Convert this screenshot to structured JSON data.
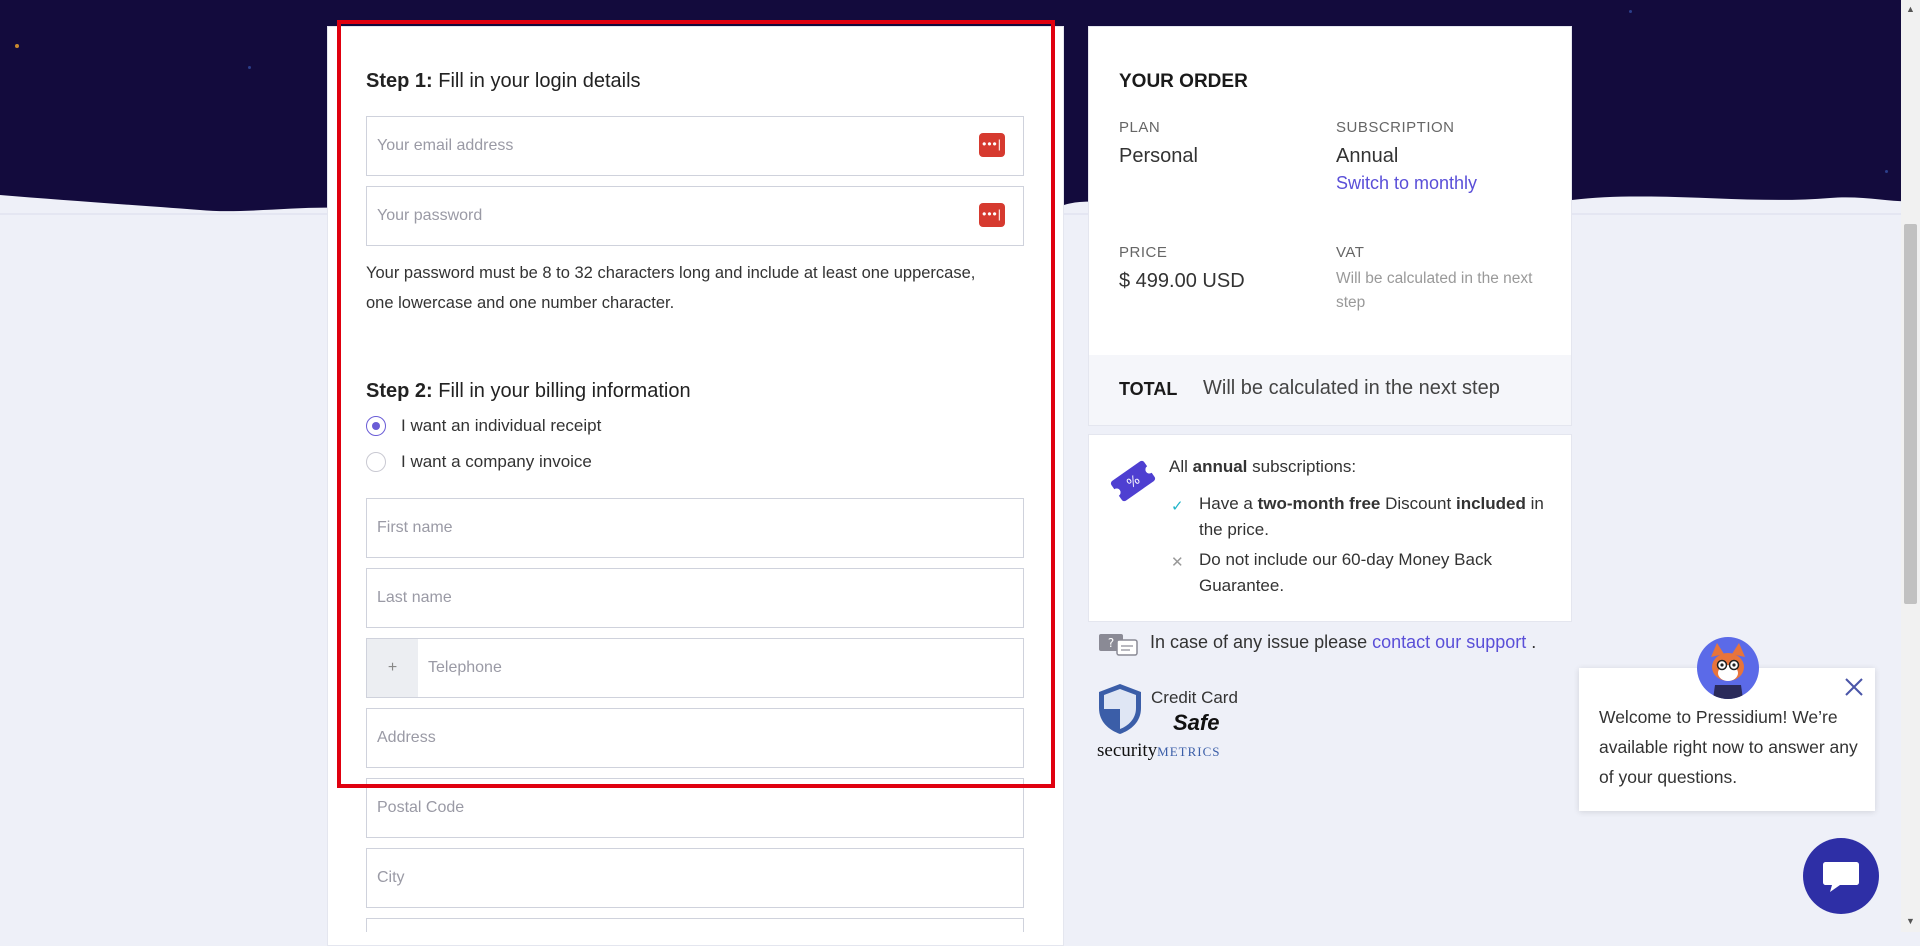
{
  "form": {
    "step1_strong": "Step 1:",
    "step1_text": " Fill in your login details",
    "email_placeholder": "Your email address",
    "password_placeholder": "Your password",
    "pm_icon_text": "•••|",
    "password_hint": "Your password must be 8 to 32 characters long and include at least one uppercase, one lowercase and one number character.",
    "step2_strong": "Step 2:",
    "step2_text": " Fill in your billing information",
    "radio_individual": "I want an individual receipt",
    "radio_company": "I want a company invoice",
    "first_name_placeholder": "First name",
    "last_name_placeholder": "Last name",
    "phone_prefix": "+",
    "telephone_placeholder": "Telephone",
    "address_placeholder": "Address",
    "postal_placeholder": "Postal Code",
    "city_placeholder": "City"
  },
  "order": {
    "title": "YOUR ORDER",
    "plan_label": "PLAN",
    "plan_value": "Personal",
    "subscription_label": "SUBSCRIPTION",
    "subscription_value": "Annual",
    "switch_link": "Switch to monthly",
    "price_label": "PRICE",
    "price_value": "$ 499.00 USD",
    "vat_label": "VAT",
    "vat_value": "Will be calculated in the next step",
    "total_label": "TOTAL",
    "total_value": "Will be calculated in the next step"
  },
  "annual": {
    "head_pre": "All ",
    "head_bold": "annual",
    "head_post": " subscriptions:",
    "b1_pre": "Have a ",
    "b1_bold": "two-month free",
    "b1_mid": " Discount ",
    "b1_bold2": "included",
    "b1_post": " in the price.",
    "b2": "Do not include our 60-day Money Back Guarantee."
  },
  "support": {
    "pre": "In case of any issue please ",
    "link": "contact our support",
    "post": " ."
  },
  "badge": {
    "line1": "Credit Card",
    "line2": "Safe",
    "line3a": "security",
    "line3b": "METRICS"
  },
  "chat": {
    "message": "Welcome to Pressidium! We’re available right now to answer any of your questions."
  },
  "colors": {
    "hero": "#130b3d",
    "accent": "#5a4fd8",
    "highlight": "#e0000f",
    "pm_icon": "#d63a2f",
    "chat_button": "#2e2fa6"
  }
}
